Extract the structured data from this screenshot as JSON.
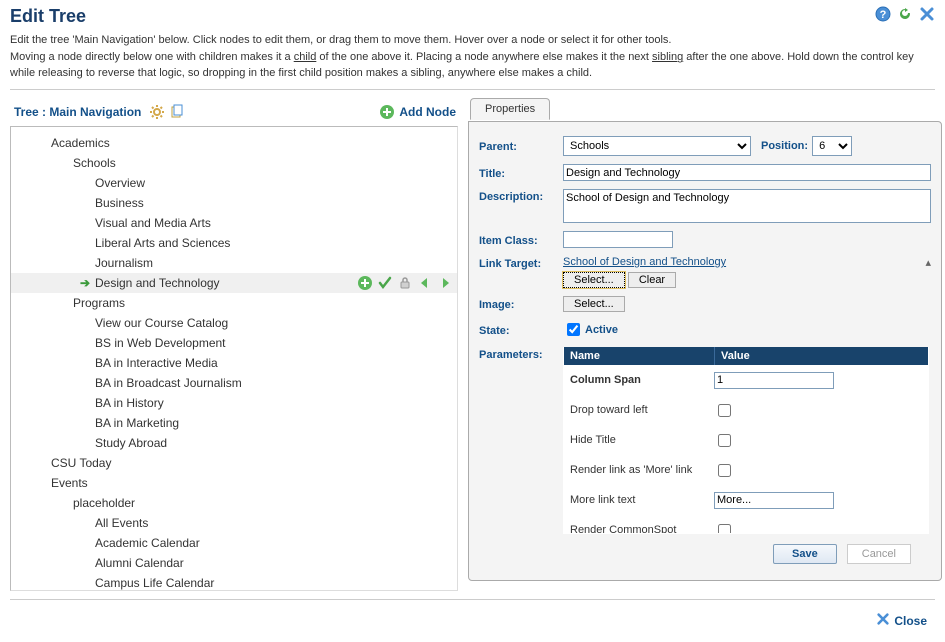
{
  "header": {
    "title": "Edit Tree",
    "help1_a": "Edit the tree 'Main Navigation' below. Click nodes to edit them, or drag them to move them. Hover over a node or select it for other tools.",
    "help2_a": "Moving a node directly below one with children makes it a ",
    "help2_child": "child",
    "help2_b": " of the one above it. Placing a node anywhere else makes it the next ",
    "help2_sibling": "sibling",
    "help2_c": " after the one above. Hold down the control key while releasing to reverse that logic, so dropping in the first child position makes a sibling, anywhere else makes a child."
  },
  "tree": {
    "label": "Tree : Main Navigation",
    "add_node": "Add Node",
    "items": [
      {
        "label": "Academics",
        "indent": 0
      },
      {
        "label": "Schools",
        "indent": 1
      },
      {
        "label": "Overview",
        "indent": 2
      },
      {
        "label": "Business",
        "indent": 2
      },
      {
        "label": "Visual and Media Arts",
        "indent": 2
      },
      {
        "label": "Liberal Arts and Sciences",
        "indent": 2
      },
      {
        "label": "Journalism",
        "indent": 2
      },
      {
        "label": "Design and Technology",
        "indent": 2,
        "selected": true
      },
      {
        "label": "Programs",
        "indent": 1
      },
      {
        "label": "View our Course Catalog",
        "indent": 2
      },
      {
        "label": "BS in Web Development",
        "indent": 2
      },
      {
        "label": "BA in Interactive Media",
        "indent": 2
      },
      {
        "label": "BA in Broadcast Journalism",
        "indent": 2
      },
      {
        "label": "BA in History",
        "indent": 2
      },
      {
        "label": "BA in Marketing",
        "indent": 2
      },
      {
        "label": "Study Abroad",
        "indent": 2
      },
      {
        "label": "CSU Today",
        "indent": 0
      },
      {
        "label": "Events",
        "indent": 0
      },
      {
        "label": "placeholder",
        "indent": 1
      },
      {
        "label": "All Events",
        "indent": 2
      },
      {
        "label": "Academic Calendar",
        "indent": 2
      },
      {
        "label": "Alumni Calendar",
        "indent": 2
      },
      {
        "label": "Campus Life Calendar",
        "indent": 2
      }
    ]
  },
  "tab": {
    "properties": "Properties"
  },
  "form": {
    "parent_label": "Parent:",
    "parent_value": "Schools",
    "position_label": "Position:",
    "position_value": "6",
    "title_label": "Title:",
    "title_value": "Design and Technology",
    "desc_label": "Description:",
    "desc_value": "School of Design and Technology",
    "itemclass_label": "Item Class:",
    "itemclass_value": "",
    "linktarget_label": "Link Target:",
    "linktarget_value": "School of Design and Technology",
    "select_btn": "Select...",
    "clear_btn": "Clear",
    "image_label": "Image:",
    "state_label": "State:",
    "state_text": "Active",
    "params_label": "Parameters:",
    "params_head_name": "Name",
    "params_head_value": "Value",
    "params": [
      {
        "name": "Column Span",
        "value": "1",
        "type": "text"
      },
      {
        "name": "Drop toward left",
        "type": "checkbox",
        "checked": false
      },
      {
        "name": "Hide Title",
        "type": "checkbox",
        "checked": false
      },
      {
        "name": "Render link as 'More' link",
        "type": "checkbox",
        "checked": false
      },
      {
        "name": "More link text",
        "value": "More...",
        "type": "text"
      },
      {
        "name": "Render CommonSpot",
        "type": "checkbox",
        "checked": false
      }
    ],
    "save": "Save",
    "cancel": "Cancel"
  },
  "footer": {
    "close": "Close"
  }
}
